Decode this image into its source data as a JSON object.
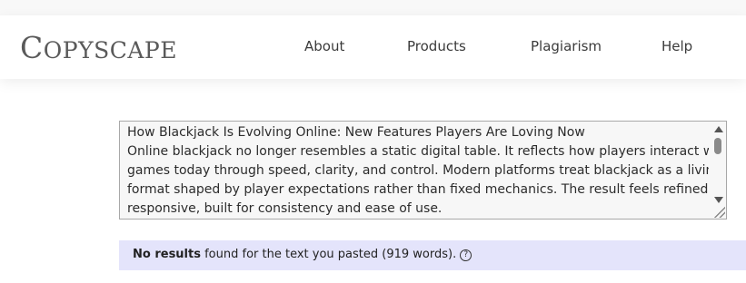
{
  "header": {
    "logo": {
      "first_letter": "C",
      "rest": "OPYSCAPE"
    },
    "nav": [
      {
        "label": "About"
      },
      {
        "label": "Products"
      },
      {
        "label": "Plagiarism"
      },
      {
        "label": "Help"
      }
    ]
  },
  "textbox": {
    "lines": [
      "How Blackjack Is Evolving Online: New Features Players Are Loving Now",
      "Online blackjack no longer resembles a static digital table. It reflects how players interact with",
      "games today through speed, clarity, and control. Modern platforms treat blackjack as a living",
      "format shaped by player expectations rather than fixed mechanics. The result feels refined and",
      "responsive, built for consistency and ease of use."
    ]
  },
  "result": {
    "bold": "No results",
    "text": " found for the text you pasted (919 words).",
    "help_icon": "?"
  },
  "colors": {
    "result_background": "#e4e4fb",
    "logo": "#5a5a5a",
    "textbox_border": "#a8a8a8"
  }
}
